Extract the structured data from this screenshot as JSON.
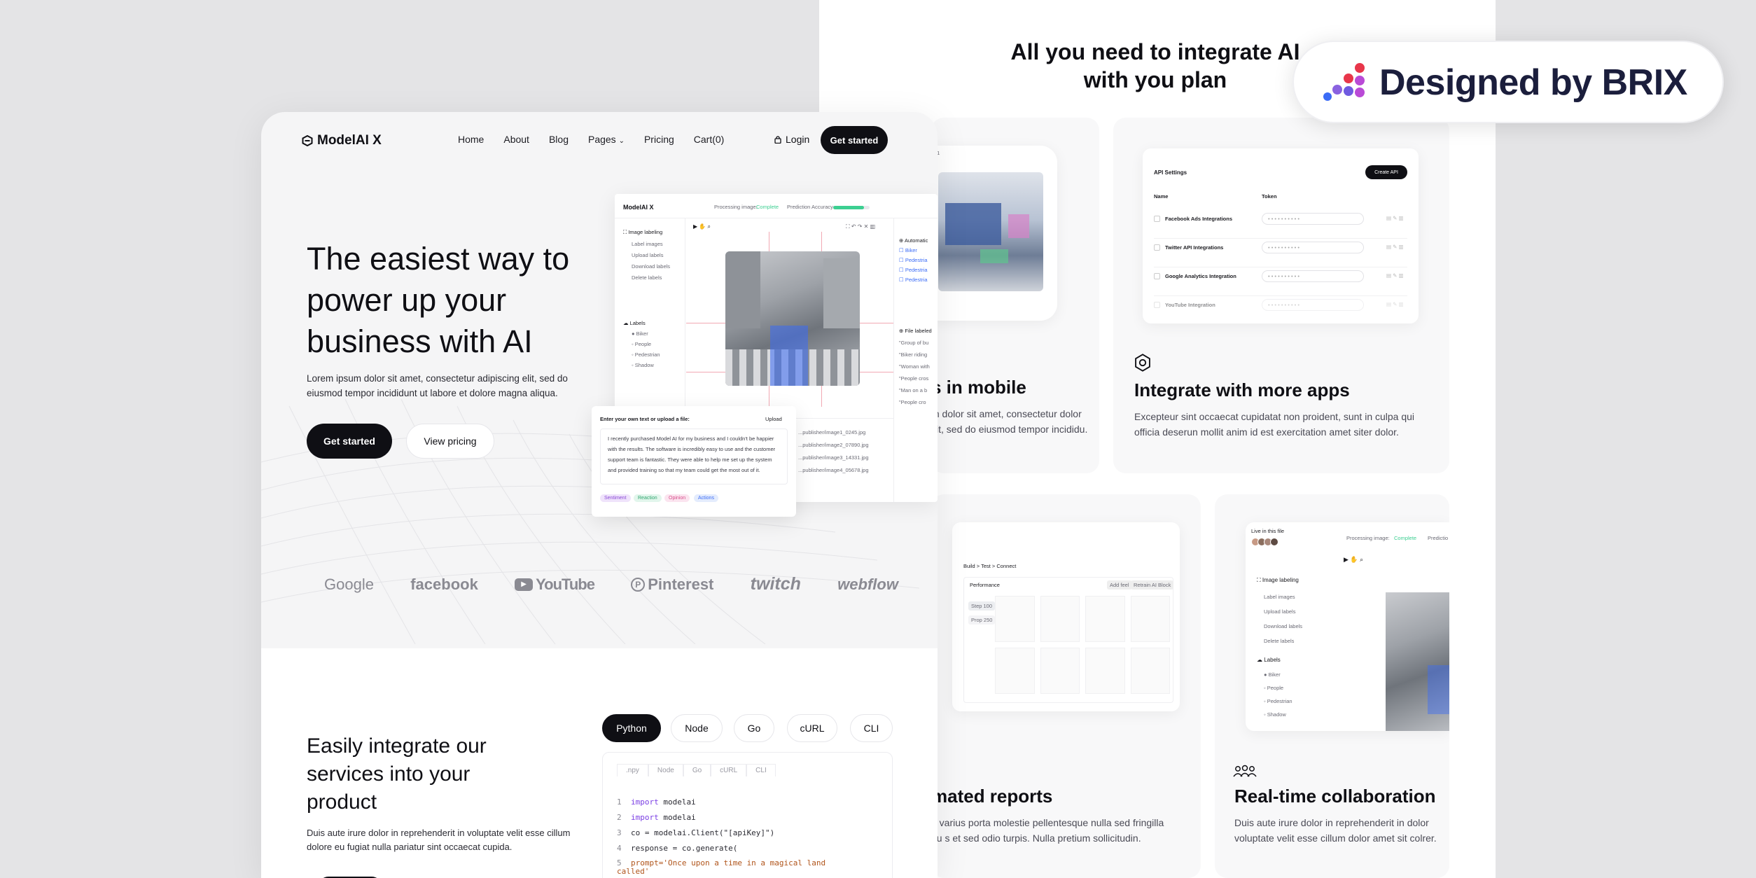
{
  "backdrop": {
    "section_title": "All you need to integrate AI with you plan",
    "mobile_card": {
      "title": "s in mobile",
      "text": "m dolor sit amet, consectetur  dolor sit, sed do eiusmod tempor incididu."
    },
    "apps_card": {
      "title": "Integrate with more apps",
      "text": "Excepteur sint occaecat cupidatat non proident, sunt in culpa qui officia deserun mollit anim id est exercitation amet siter dolor.",
      "mock": {
        "heading": "API Settings",
        "button": "Create API",
        "col_name": "Name",
        "col_token": "Token",
        "rows": [
          "Facebook Ads Integrations",
          "Twitter API Integrations",
          "Google Analytics Integration",
          "YouTube Integration"
        ],
        "token_mask": "• • • • • • • • • •"
      }
    },
    "reports_card": {
      "title": "mated reports",
      "text": "n varius porta molestie pellentesque nulla sed fringilla eu s et sed odio turpis. Nulla pretium sollicitudin.",
      "mock": {
        "breadcrumb": "Build  >  Test  >  Connect",
        "table_title": "Performance",
        "btn_add": "Add feel",
        "btn_retrain": "Retrain AI Block",
        "side_a": "Step 100",
        "side_b": "Prop 250"
      }
    },
    "collab_card": {
      "title": "Real-time collaboration",
      "text": "Duis aute irure dolor in reprehenderit in dolor voluptate velit esse cillum dolor amet sit colrer.",
      "mock": {
        "live": "Live in this file",
        "processing": "Processing image:",
        "status": "Complete",
        "predict": "Predictio",
        "nav": [
          "Image labeling",
          "Label images",
          "Upload labels",
          "Download labels",
          "Delete labels"
        ],
        "labels_head": "Labels",
        "labels": [
          "Biker",
          "People",
          "Pedestrian",
          "Shadow"
        ]
      }
    }
  },
  "brix": {
    "label": "Designed by BRIX"
  },
  "front": {
    "brand": "ModelAI X",
    "nav": [
      "Home",
      "About",
      "Blog",
      "Pages",
      "Pricing",
      "Cart(0)"
    ],
    "login": "Login",
    "cta_nav": "Get started",
    "hero_title": "The easiest way to power up your business with AI",
    "hero_text": "Lorem ipsum dolor sit amet, consectetur adipiscing elit, sed do eiusmod tempor incididunt ut labore et dolore magna aliqua.",
    "cta_primary": "Get started",
    "cta_secondary": "View pricing",
    "logos": [
      "Google",
      "facebook",
      "YouTube",
      "Pinterest",
      "twitch",
      "webflow"
    ],
    "integrate_title": "Easily integrate our services into your product",
    "integrate_text": "Duis aute irure dolor in reprehenderit in voluptate velit esse cillum dolore eu fugiat nulla pariatur sint occaecat cupida.",
    "lang_tabs": [
      "Python",
      "Node",
      "Go",
      "cURL",
      "CLI"
    ],
    "code_tabs": [
      ".npy",
      "Node",
      "Go",
      "cURL",
      "CLI"
    ],
    "code": [
      {
        "n": "1",
        "kw": "import",
        "rest": " modelai"
      },
      {
        "n": "2",
        "kw": "import",
        "rest": " modelai"
      },
      {
        "n": "3",
        "kw": "",
        "rest": "co = modelai.Client(\"[apiKey]\")"
      },
      {
        "n": "4",
        "kw": "",
        "rest": "response = co.generate("
      },
      {
        "n": "5",
        "kw": "",
        "rest": "prompt='Once upon a time in a magical land called'"
      }
    ],
    "dashboard": {
      "brand": "ModelAI X",
      "processing": "Processing image:",
      "status": "Complete",
      "accuracy": "Prediction Accuracy",
      "accuracy_value": 0.85,
      "nav": [
        "Image labeling",
        "Label images",
        "Upload labels",
        "Download labels",
        "Delete labels"
      ],
      "labels_head": "Labels",
      "labels": [
        "Biker",
        "People",
        "Pedestrian",
        "Shadow"
      ],
      "right_head": "Automatic",
      "right_items": [
        "Biker",
        "Pedestria",
        "Pedestria",
        "Pedestria"
      ],
      "file_head": "File labeled",
      "file_items": [
        "\"Group of bu",
        "\"Biker riding",
        "\"Woman with",
        "\"People cros",
        "\"Man on a b",
        "\"People cro"
      ],
      "files": [
        "...publisher/image1_0245.jpg",
        "...publisher/image2_07890.jpg",
        "...publisher/image3_14331.jpg",
        "...publisher/image4_05678.jpg"
      ]
    },
    "text_card": {
      "label": "Enter your own text or upload a file:",
      "upload": "Upload",
      "body": "I recently purchased Model AI for my business and I couldn't be happier with the results. The software is incredibly easy to use and the customer support team is fantastic. They were able to help me set up the system and provided training so that my team could get the most out of it.",
      "pills": [
        "Sentiment",
        "Reaction",
        "Opinion",
        "Actions"
      ]
    }
  },
  "colors": {
    "dark": "#0f0f14",
    "accent_green": "#3ccf91",
    "accent_blue": "#3b6cf6",
    "brix_navy": "#1b1e3c"
  }
}
